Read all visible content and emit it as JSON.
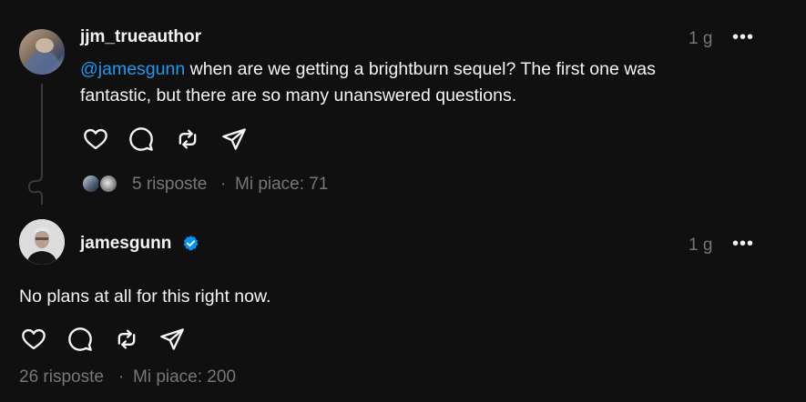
{
  "post1": {
    "username": "jjm_trueauthor",
    "time": "1 g",
    "more": "•••",
    "mention": "@jamesgunn",
    "text_line1": " when are we getting a brightburn sequel? The first one was",
    "text_line2": "fantastic, but there are so many unanswered questions.",
    "replies": "5 risposte",
    "separator": "·",
    "likes": "Mi piace: 71"
  },
  "post2": {
    "username": "jamesgunn",
    "time": "1 g",
    "more": "•••",
    "text": "No plans at all for this right now.",
    "replies": "26 risposte",
    "separator": "·",
    "likes": "Mi piace: 200"
  },
  "icons": {
    "like": "heart-icon",
    "comment": "comment-icon",
    "repost": "repost-icon",
    "share": "send-icon",
    "verified": "verified-badge-icon",
    "more": "more-icon"
  },
  "colors": {
    "background": "#101010",
    "text": "#f3f5f7",
    "muted": "#777777",
    "mention": "#1d9bf0",
    "verified": "#0095f6"
  }
}
